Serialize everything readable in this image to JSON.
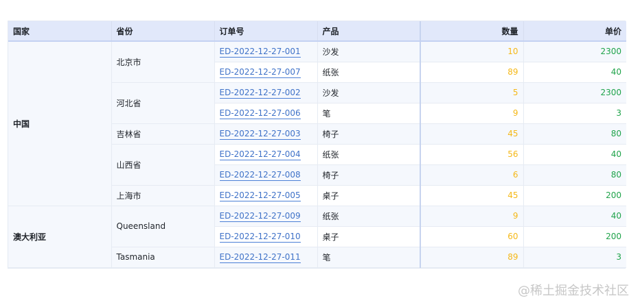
{
  "headers": {
    "country": "国家",
    "province": "省份",
    "order": "订单号",
    "product": "产品",
    "quantity": "数量",
    "price": "单价"
  },
  "groups": [
    {
      "country": "中国",
      "provinces": [
        {
          "name": "北京市",
          "rows": [
            {
              "order": "ED-2022-12-27-001",
              "product": "沙发",
              "quantity": "10",
              "price": "2300"
            },
            {
              "order": "ED-2022-12-27-007",
              "product": "纸张",
              "quantity": "89",
              "price": "40"
            }
          ]
        },
        {
          "name": "河北省",
          "rows": [
            {
              "order": "ED-2022-12-27-002",
              "product": "沙发",
              "quantity": "5",
              "price": "2300"
            },
            {
              "order": "ED-2022-12-27-006",
              "product": "笔",
              "quantity": "9",
              "price": "3"
            }
          ]
        },
        {
          "name": "吉林省",
          "rows": [
            {
              "order": "ED-2022-12-27-003",
              "product": "椅子",
              "quantity": "45",
              "price": "80"
            }
          ]
        },
        {
          "name": "山西省",
          "rows": [
            {
              "order": "ED-2022-12-27-004",
              "product": "纸张",
              "quantity": "56",
              "price": "40"
            },
            {
              "order": "ED-2022-12-27-008",
              "product": "椅子",
              "quantity": "6",
              "price": "80"
            }
          ]
        },
        {
          "name": "上海市",
          "rows": [
            {
              "order": "ED-2022-12-27-005",
              "product": "桌子",
              "quantity": "45",
              "price": "200"
            }
          ]
        }
      ]
    },
    {
      "country": "澳大利亚",
      "provinces": [
        {
          "name": "Queensland",
          "rows": [
            {
              "order": "ED-2022-12-27-009",
              "product": "纸张",
              "quantity": "9",
              "price": "40"
            },
            {
              "order": "ED-2022-12-27-010",
              "product": "桌子",
              "quantity": "60",
              "price": "200"
            }
          ]
        },
        {
          "name": "Tasmania",
          "rows": [
            {
              "order": "ED-2022-12-27-011",
              "product": "笔",
              "quantity": "89",
              "price": "3"
            }
          ]
        }
      ]
    }
  ],
  "colors": {
    "header_bg": "#e1e8fa",
    "link": "#3f72c8",
    "quantity": "#f5b817",
    "price": "#1fa34a"
  },
  "watermark": "@稀土掘金技术社区"
}
